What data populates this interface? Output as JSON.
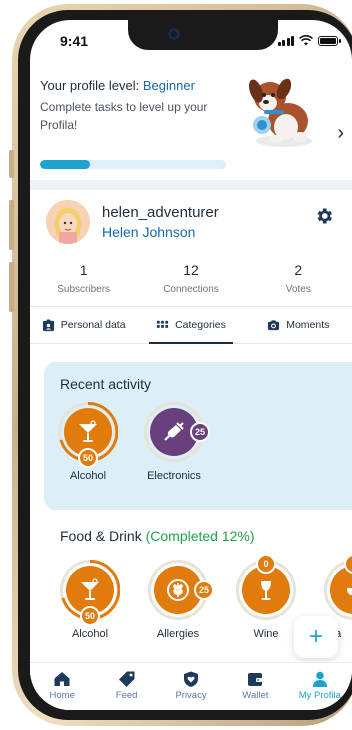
{
  "status_bar": {
    "time": "9:41"
  },
  "level_card": {
    "title_prefix": "Your profile level: ",
    "level": "Beginner",
    "description": "Complete tasks to level up your Profila!",
    "progress": 0.27
  },
  "profile": {
    "username": "helen_adventurer",
    "full_name": "Helen Johnson",
    "stats": [
      {
        "value": "1",
        "label": "Subscribers"
      },
      {
        "value": "12",
        "label": "Connections"
      },
      {
        "value": "2",
        "label": "Votes"
      }
    ]
  },
  "tabs": [
    {
      "label": "Personal data",
      "icon": "id-card-icon",
      "active": false
    },
    {
      "label": "Categories",
      "icon": "grid-icon",
      "active": true
    },
    {
      "label": "Moments",
      "icon": "camera-icon",
      "active": false
    }
  ],
  "recent_activity": {
    "title": "Recent activity",
    "items": [
      {
        "label": "Alcohol",
        "badge": "50",
        "icon": "cocktail-icon",
        "color": "#e07b0c"
      },
      {
        "label": "Electronics",
        "badge": "25",
        "icon": "plug-icon",
        "color": "#6a3f7d"
      }
    ]
  },
  "section": {
    "title": "Food & Drink",
    "completion": "(Completed 12%)",
    "items": [
      {
        "label": "Alcohol",
        "badge": "50",
        "icon": "cocktail-icon",
        "color": "#e07b0c"
      },
      {
        "label": "Allergies",
        "badge": "25",
        "icon": "wheat-icon",
        "color": "#e07b0c"
      },
      {
        "label": "Wine",
        "badge": "0",
        "icon": "wine-glass-icon",
        "color": "#e07b0c"
      },
      {
        "label": "e a",
        "badge": "",
        "icon": "food-icon",
        "color": "#e07b0c"
      }
    ]
  },
  "fab": {
    "label": "+"
  },
  "bottom_nav": [
    {
      "label": "Home",
      "icon": "home-icon",
      "active": false
    },
    {
      "label": "Feed",
      "icon": "tag-icon",
      "active": false
    },
    {
      "label": "Privacy",
      "icon": "shield-heart-icon",
      "active": false
    },
    {
      "label": "Wallet",
      "icon": "wallet-icon",
      "active": false
    },
    {
      "label": "My Profila",
      "icon": "user-icon",
      "active": true
    }
  ],
  "colors": {
    "accent": "#1ea3cf",
    "level_blue": "#1769a8",
    "category_orange": "#e07b0c",
    "electronics_purple": "#6a3f7d",
    "completion_green": "#1fa34a"
  }
}
